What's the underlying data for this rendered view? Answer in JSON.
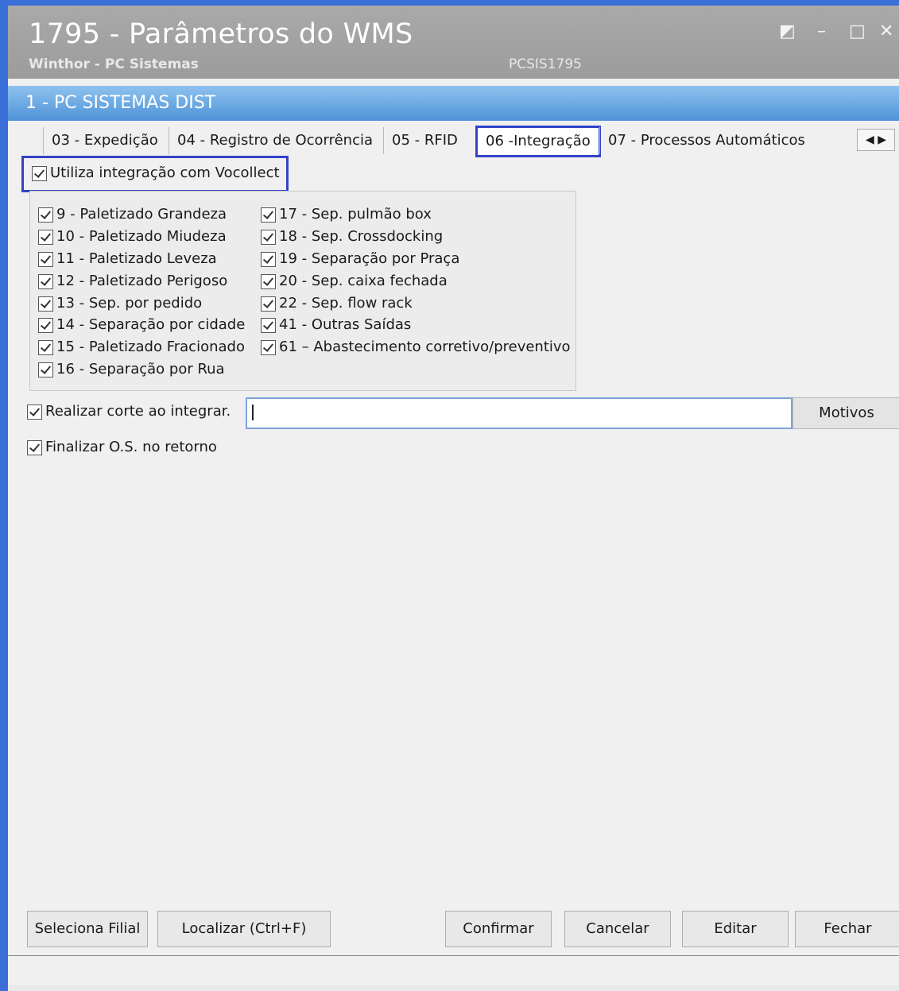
{
  "window": {
    "title": "1795 - Parâmetros do WMS",
    "subtitle": "Winthor - PC Sistemas",
    "code": "PCSIS1795",
    "company": "1 - PC SISTEMAS DIST"
  },
  "tabs": [
    {
      "label": "03 - Expedição"
    },
    {
      "label": "04 - Registro de Ocorrência"
    },
    {
      "label": "05 - RFID"
    },
    {
      "label": "06 -Integração"
    },
    {
      "label": "07 - Processos Automáticos"
    }
  ],
  "integration": {
    "vocollect_label": "Utiliza integração com Vocollect",
    "left_items": [
      "9 - Paletizado Grandeza",
      "10 - Paletizado Miudeza",
      "11 - Paletizado Leveza",
      "12 - Paletizado Perigoso",
      "13 - Sep. por pedido",
      "14 - Separação por cidade",
      "15 - Paletizado Fracionado",
      "16 - Separação por Rua"
    ],
    "right_items": [
      "17 - Sep. pulmão box",
      "18 - Sep. Crossdocking",
      "19 - Separação por Praça",
      "20 - Sep. caixa fechada",
      "22 - Sep. flow rack",
      "41 - Outras Saídas",
      "61 – Abastecimento corretivo/preventivo"
    ],
    "cut_label": "Realizar corte ao integrar.",
    "cut_value": "",
    "motivos_label": "Motivos",
    "finalize_label": "Finalizar O.S. no retorno"
  },
  "buttons": {
    "select_branch": "Seleciona Filial",
    "locate": "Localizar (Ctrl+F)",
    "confirm": "Confirmar",
    "cancel": "Cancelar",
    "edit": "Editar",
    "close": "Fechar"
  }
}
